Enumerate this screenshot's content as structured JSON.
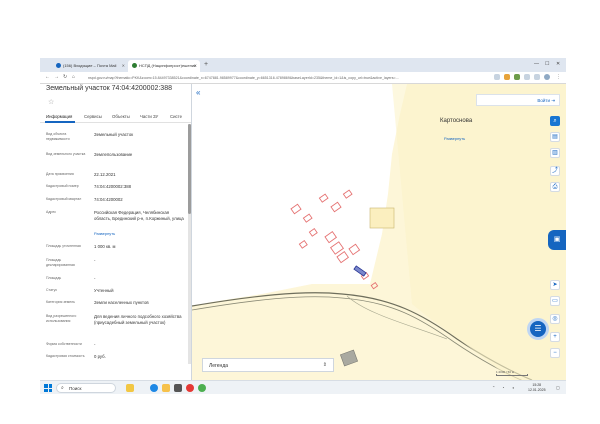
{
  "browser": {
    "tabs": [
      {
        "label": "(156) Входящие – Почта Mail"
      },
      {
        "label": "НСПД (Нацинфопрост)ешение"
      }
    ],
    "url": "nspd.gov.ru/map?thematic=PKK&zoom=15.84497338521&coordinate_x=6747881.98589977&coordinate_y=6651316.4789869&baseLayerId=235&theme_id=1&is_copy_url=true&active_layers=..."
  },
  "panel": {
    "title": "Земельный участок 74:04:4200002:388",
    "tabs": [
      "Информация",
      "Сервисы",
      "Объекты",
      "Части ЗУ",
      "Систе"
    ],
    "fields": [
      {
        "label": "Вид объекта недвижимости",
        "value": "Земельный участок"
      },
      {
        "label": "Вид земельного участка",
        "value": "Землепользование"
      },
      {
        "label": "Дата присвоения",
        "value": "22.12.2021"
      },
      {
        "label": "Кадастровый номер",
        "value": "74:04:4200002:388"
      },
      {
        "label": "Кадастровый квартал",
        "value": "74:04:4200002"
      },
      {
        "label": "Адрес",
        "value": "Российская Федерация, Челябинская область, Брединский р-н, п.Коржиный, улица",
        "link": "Развернуть"
      },
      {
        "label": "Площадь уточненная",
        "value": "1 000 кв. м"
      },
      {
        "label": "Площадь декларированная",
        "value": "-"
      },
      {
        "label": "Площадь",
        "value": "-"
      },
      {
        "label": "Статус",
        "value": "Учтенный"
      },
      {
        "label": "Категория земель",
        "value": "Земли населенных пунктов"
      },
      {
        "label": "Вид разрешенного использования",
        "value": "Для ведения личного подсобного хозяйства (приусадебный земельный участок)"
      },
      {
        "label": "Форма собственности",
        "value": "-"
      },
      {
        "label": "Кадастровая стоимость",
        "value": "0 руб."
      }
    ]
  },
  "map": {
    "collapse_icon": "«",
    "login_label": "Войти",
    "place_name": "Картоснова",
    "place_link": "Развернуть",
    "legend_label": "Легенда",
    "scale_label": "1:2000 / 50 м",
    "right_tools": [
      "search-icon",
      "layers-icon",
      "measure-icon",
      "share-icon",
      "print-icon"
    ],
    "zoom_tools": [
      "locate-icon",
      "draw-icon",
      "geolocation-icon",
      "zoom-in-icon",
      "zoom-out-icon"
    ]
  },
  "taskbar": {
    "search_label": "Поиск",
    "time": "15:28",
    "date": "12.01.2025"
  },
  "colors": {
    "accent": "#1565c0",
    "map_bg": "#fdf6d8",
    "parcel_stroke": "#e57373",
    "selected_parcel": "#3949ab"
  }
}
